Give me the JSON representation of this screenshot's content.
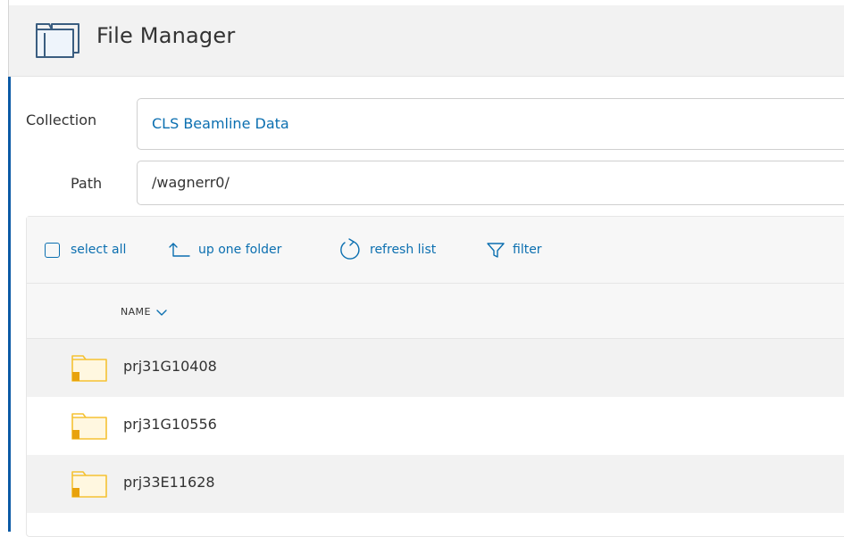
{
  "header": {
    "title": "File Manager",
    "icon": "folder-icon"
  },
  "form": {
    "collection_label": "Collection",
    "collection_value": "CLS Beamline Data",
    "path_label": "Path",
    "path_value": "/wagnerr0/"
  },
  "toolbar": {
    "select_all": "select all",
    "up_one_folder": "up one folder",
    "refresh_list": "refresh list",
    "filter": "filter"
  },
  "table": {
    "column_name": "NAME",
    "rows": [
      {
        "name": "prj31G10408",
        "icon": "shared-folder-icon"
      },
      {
        "name": "prj31G10556",
        "icon": "shared-folder-icon"
      },
      {
        "name": "prj33E11628",
        "icon": "shared-folder-icon"
      }
    ]
  },
  "colors": {
    "accent": "#0b5aa5",
    "link": "#0b6fb0",
    "folder": "#f5c233",
    "folder_badge": "#e8a20c"
  }
}
